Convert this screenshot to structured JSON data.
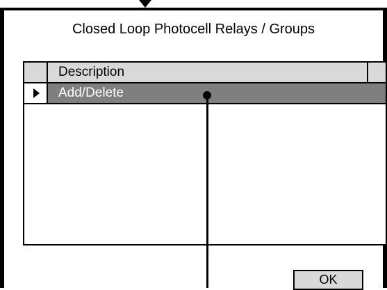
{
  "dialog": {
    "title": "Closed Loop Photocell Relays / Groups"
  },
  "grid": {
    "columns": [
      "Description"
    ],
    "rows": [
      {
        "description": "Add/Delete",
        "selected": true
      }
    ]
  },
  "buttons": {
    "ok_label": "OK"
  },
  "icons": {
    "pointer": "down-arrow-icon",
    "row_selector": "play-triangle-icon",
    "callout": "callout-dot-icon"
  },
  "colors": {
    "header_bg": "#d9d9d9",
    "selected_row_bg": "#7f7f7f",
    "selected_row_text": "#ffffff",
    "frame": "#000000"
  }
}
